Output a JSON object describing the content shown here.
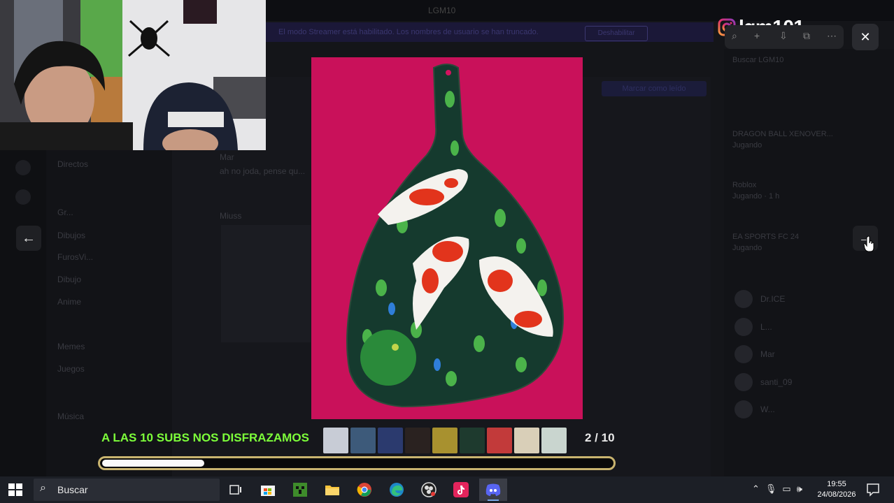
{
  "overlay": {
    "instagram_handle": "lgm101_",
    "subs_banner": "A LAS 10 SUBS NOS DISFRAZAMOS",
    "counter": "2 / 10",
    "progress_fraction": 0.2
  },
  "background": {
    "window_title": "LGM10",
    "notice_text": "El modo Streamer está habilitado. Los nombres de usuario se han truncado.",
    "notice_button": "Deshabilitar",
    "mark_read_button": "Marcar como leído",
    "search_placeholder": "Buscar LGM10",
    "channels": [
      "Directos",
      "Gr...",
      "Dibujos",
      "FurosVi...",
      "Dibujo",
      "Anime",
      "Memes",
      "Juegos",
      "Música"
    ],
    "chat": [
      {
        "author": "Mar",
        "text": "ah no joda, pense qu..."
      },
      {
        "author": "Miuss",
        "text": ""
      }
    ],
    "activities": [
      {
        "title": "DRAGON BALL XENOVER...",
        "sub": "Jugando"
      },
      {
        "title": "Roblox",
        "sub": "Jugando · 1 h"
      },
      {
        "title": "EA SPORTS FC 24",
        "sub": "Jugando"
      }
    ],
    "members": [
      "Dr.ICE",
      "L...",
      "Mar",
      "santi_09",
      "W...",
      "..."
    ]
  },
  "taskbar": {
    "search_label": "Buscar",
    "time": "19:55",
    "date": "24/08/2026",
    "apps": [
      "task-view",
      "microsoft-store",
      "minecraft",
      "file-explorer",
      "chrome",
      "edge",
      "obs",
      "tiktok",
      "discord"
    ]
  },
  "colors": {
    "subs_text": "#7dff3a",
    "progress_border": "#c9b46f",
    "photo_background": "#d3135f"
  }
}
